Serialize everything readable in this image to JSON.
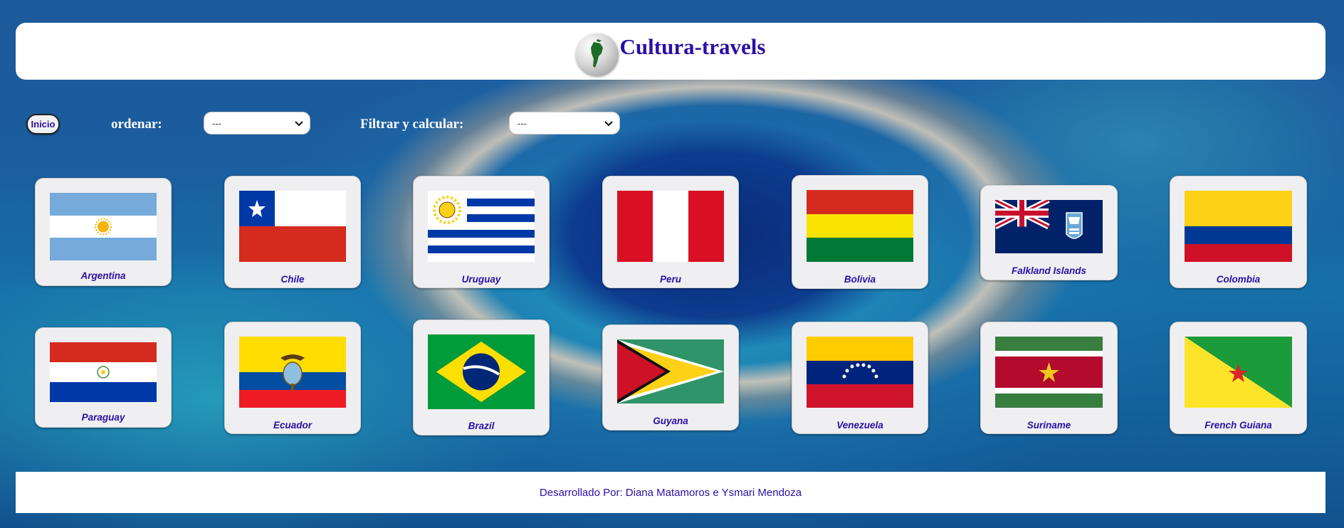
{
  "header": {
    "title": "Cultura-travels",
    "logo_icon": "globe-south-america-icon"
  },
  "controls": {
    "home_button": "Inicio",
    "sort_label": "ordenar:",
    "sort_select": "---",
    "filter_label": "Filtrar y calcular:",
    "filter_select": "---"
  },
  "countries": [
    "Argentina",
    "Chile",
    "Uruguay",
    "Peru",
    "Bolivia",
    "Falkland Islands",
    "Colombia",
    "Paraguay",
    "Ecuador",
    "Brazil",
    "Guyana",
    "Venezuela",
    "Suriname",
    "French Guiana"
  ],
  "footer": {
    "credit": "Desarrollado Por: Diana Matamoros e Ysmari Mendoza"
  },
  "colors": {
    "accent": "#2b0ea6",
    "card": "#efeff1"
  }
}
